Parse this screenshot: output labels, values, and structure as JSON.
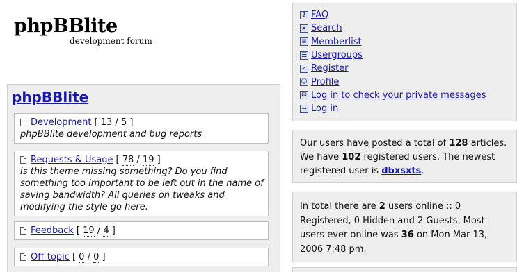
{
  "site": {
    "title": "phpBBlite",
    "subtitle": "development forum"
  },
  "forum": {
    "title": "phpBBlite",
    "categories": [
      {
        "name": "Development",
        "posts": "13",
        "topics": "5",
        "description": "phpBBlite development and bug reports"
      },
      {
        "name": "Requests & Usage",
        "posts": "78",
        "topics": "19",
        "description": "Is this theme missing something? Do you find something too important to be left out in the name of saving bandwidth? All queries on tweaks and modifying the style go here."
      },
      {
        "name": "Feedback",
        "posts": "19",
        "topics": "4"
      },
      {
        "name": "Off-topic",
        "posts": "0",
        "topics": "0"
      }
    ]
  },
  "nav": {
    "items": [
      {
        "label": "FAQ",
        "icon": "faq-icon"
      },
      {
        "label": "Search",
        "icon": "search-icon"
      },
      {
        "label": "Memberlist",
        "icon": "memberlist-icon"
      },
      {
        "label": "Usergroups",
        "icon": "usergroups-icon"
      },
      {
        "label": "Register",
        "icon": "register-icon"
      },
      {
        "label": "Profile",
        "icon": "profile-icon"
      },
      {
        "label": "Log in to check your private messages",
        "icon": "messages-icon"
      },
      {
        "label": "Log in",
        "icon": "login-icon"
      }
    ]
  },
  "stats": {
    "prefix": "Our users have posted a total of ",
    "articles": "128",
    "mid": " articles. We have ",
    "registered": "102",
    "mid2": " registered users. The newest registered user is ",
    "newest_user": "dbxsxts",
    "suffix": "."
  },
  "online": {
    "prefix": "In total there are ",
    "users": "2",
    "mid": " users online :: 0 Registered, 0 Hidden and 2 Guests. Most users ever online was ",
    "max": "36",
    "suffix": " on Mon Mar 13, 2006 7:48 pm."
  }
}
